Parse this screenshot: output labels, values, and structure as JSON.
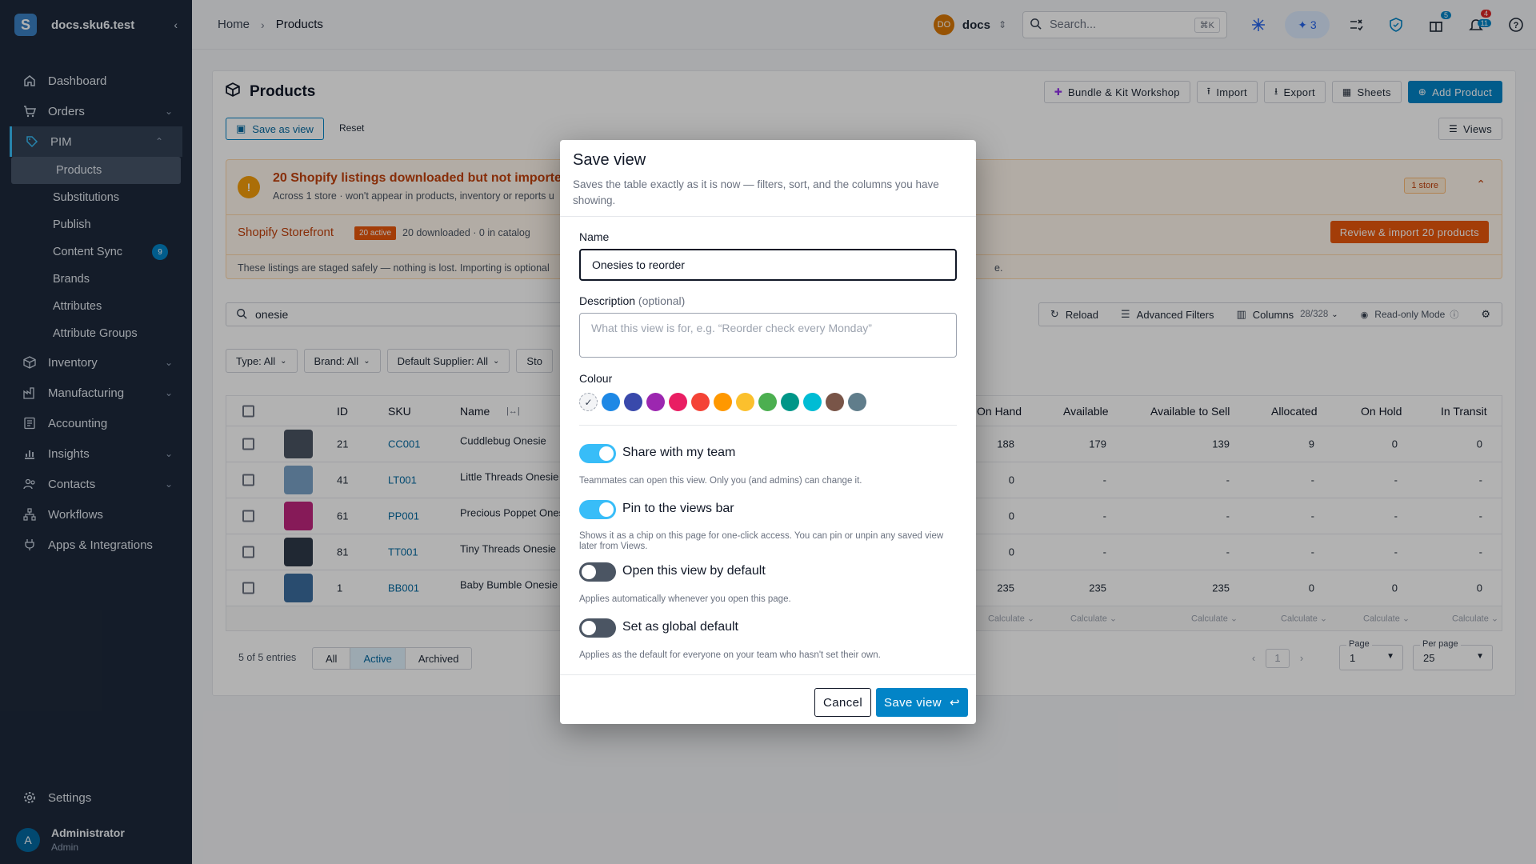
{
  "sidebar": {
    "brand": "docs.sku6.test",
    "logo_letter": "S",
    "items": [
      {
        "label": "Dashboard"
      },
      {
        "label": "Orders"
      },
      {
        "label": "PIM"
      },
      {
        "label": "Inventory"
      },
      {
        "label": "Manufacturing"
      },
      {
        "label": "Accounting"
      },
      {
        "label": "Insights"
      },
      {
        "label": "Contacts"
      },
      {
        "label": "Workflows"
      },
      {
        "label": "Apps & Integrations"
      }
    ],
    "pim_children": [
      {
        "label": "Products"
      },
      {
        "label": "Substitutions"
      },
      {
        "label": "Publish"
      },
      {
        "label": "Content Sync",
        "badge": "9"
      },
      {
        "label": "Brands"
      },
      {
        "label": "Attributes"
      },
      {
        "label": "Attribute Groups"
      }
    ],
    "settings": "Settings",
    "user": {
      "initial": "A",
      "name": "Administrator",
      "role": "Admin"
    }
  },
  "topbar": {
    "breadcrumb": [
      "Home",
      "Products"
    ],
    "workspace": {
      "initials": "DO",
      "name": "docs"
    },
    "search_placeholder": "Search...",
    "search_shortcut": "⌘K",
    "ai_count": "3",
    "gift_badge": "5",
    "bell_badge_top": "4",
    "bell_badge_bottom": "11"
  },
  "page": {
    "title": "Products",
    "actions": [
      "Bundle & Kit Workshop",
      "Import",
      "Export",
      "Sheets",
      "Add Product"
    ],
    "save_as_view": "Save as view",
    "reset": "Reset",
    "views": "Views"
  },
  "banner": {
    "title": "20 Shopify listings downloaded but not imported y",
    "subtitle": "Across 1 store · won't appear in products, inventory or reports u",
    "store_count": "1 store",
    "store_name": "Shopify Storefront",
    "store_badge": "20 active",
    "store_meta": "20 downloaded · 0 in catalog",
    "review_button": "Review & import 20 products",
    "footer_left": "These listings are staged safely — nothing is lost. Importing is optional",
    "footer_right": "e."
  },
  "filters": {
    "search_value": "onesie",
    "tools": {
      "reload": "Reload",
      "advanced": "Advanced Filters",
      "columns": "Columns",
      "columns_count": "28/328",
      "readonly": "Read-only Mode"
    },
    "chips": [
      "Type: All",
      "Brand: All",
      "Default Supplier: All",
      "Sto"
    ]
  },
  "table": {
    "headers": {
      "id": "ID",
      "sku": "SKU",
      "name": "Name",
      "on_hand": "On Hand",
      "available": "Available",
      "ats": "Available to Sell",
      "allocated": "Allocated",
      "on_hold": "On Hold",
      "in_transit": "In Transit"
    },
    "rows": [
      {
        "id": "21",
        "sku": "CC001",
        "name": "Cuddlebug Onesie",
        "on_hand": "188",
        "available": "179",
        "ats": "139",
        "allocated": "9",
        "on_hold": "0",
        "in_transit": "0",
        "thumb": "#4b5563"
      },
      {
        "id": "41",
        "sku": "LT001",
        "name": "Little Threads Onesie",
        "on_hand": "0",
        "available": "-",
        "ats": "-",
        "allocated": "-",
        "on_hold": "-",
        "in_transit": "-",
        "thumb": "#7aa2c8"
      },
      {
        "id": "61",
        "sku": "PP001",
        "name": "Precious Poppet Ones",
        "on_hand": "0",
        "available": "-",
        "ats": "-",
        "allocated": "-",
        "on_hold": "-",
        "in_transit": "-",
        "thumb": "#c0267e"
      },
      {
        "id": "81",
        "sku": "TT001",
        "name": "Tiny Threads Onesie",
        "on_hand": "0",
        "available": "-",
        "ats": "-",
        "allocated": "-",
        "on_hold": "-",
        "in_transit": "-",
        "thumb": "#2f3a4a"
      },
      {
        "id": "1",
        "sku": "BB001",
        "name": "Baby Bumble Onesie",
        "on_hand": "235",
        "available": "235",
        "ats": "235",
        "allocated": "0",
        "on_hold": "0",
        "in_transit": "0",
        "thumb": "#3b6ea0"
      }
    ],
    "calculate": "Calculate"
  },
  "pagination": {
    "info": "5 of 5 entries",
    "segments": [
      "All",
      "Active",
      "Archived"
    ],
    "current_page": "1",
    "page_label": "Page",
    "page_value": "1",
    "per_page_label": "Per page",
    "per_page_value": "25"
  },
  "modal": {
    "title": "Save view",
    "description": "Saves the table exactly as it is now — filters, sort, and the columns you have showing.",
    "name_label": "Name",
    "name_value": "Onesies to reorder",
    "desc_label": "Description",
    "desc_optional": "(optional)",
    "desc_placeholder": "What this view is for, e.g. “Reorder check every Monday”",
    "colour_label": "Colour",
    "colours": [
      "#1e88e5",
      "#3949ab",
      "#9c27b0",
      "#e91e63",
      "#f44336",
      "#ff9800",
      "#fbc02d",
      "#4caf50",
      "#009688",
      "#00bcd4",
      "#795548",
      "#607d8b"
    ],
    "toggles": [
      {
        "label": "Share with my team",
        "help": "Teammates can open this view. Only you (and admins) can change it.",
        "on": true
      },
      {
        "label": "Pin to the views bar",
        "help": "Shows it as a chip on this page for one-click access. You can pin or unpin any saved view later from Views.",
        "on": true
      },
      {
        "label": "Open this view by default",
        "help": "Applies automatically whenever you open this page.",
        "on": false
      },
      {
        "label": "Set as global default",
        "help": "Applies as the default for everyone on your team who hasn't set their own.",
        "on": false
      }
    ],
    "cancel": "Cancel",
    "save": "Save view"
  }
}
